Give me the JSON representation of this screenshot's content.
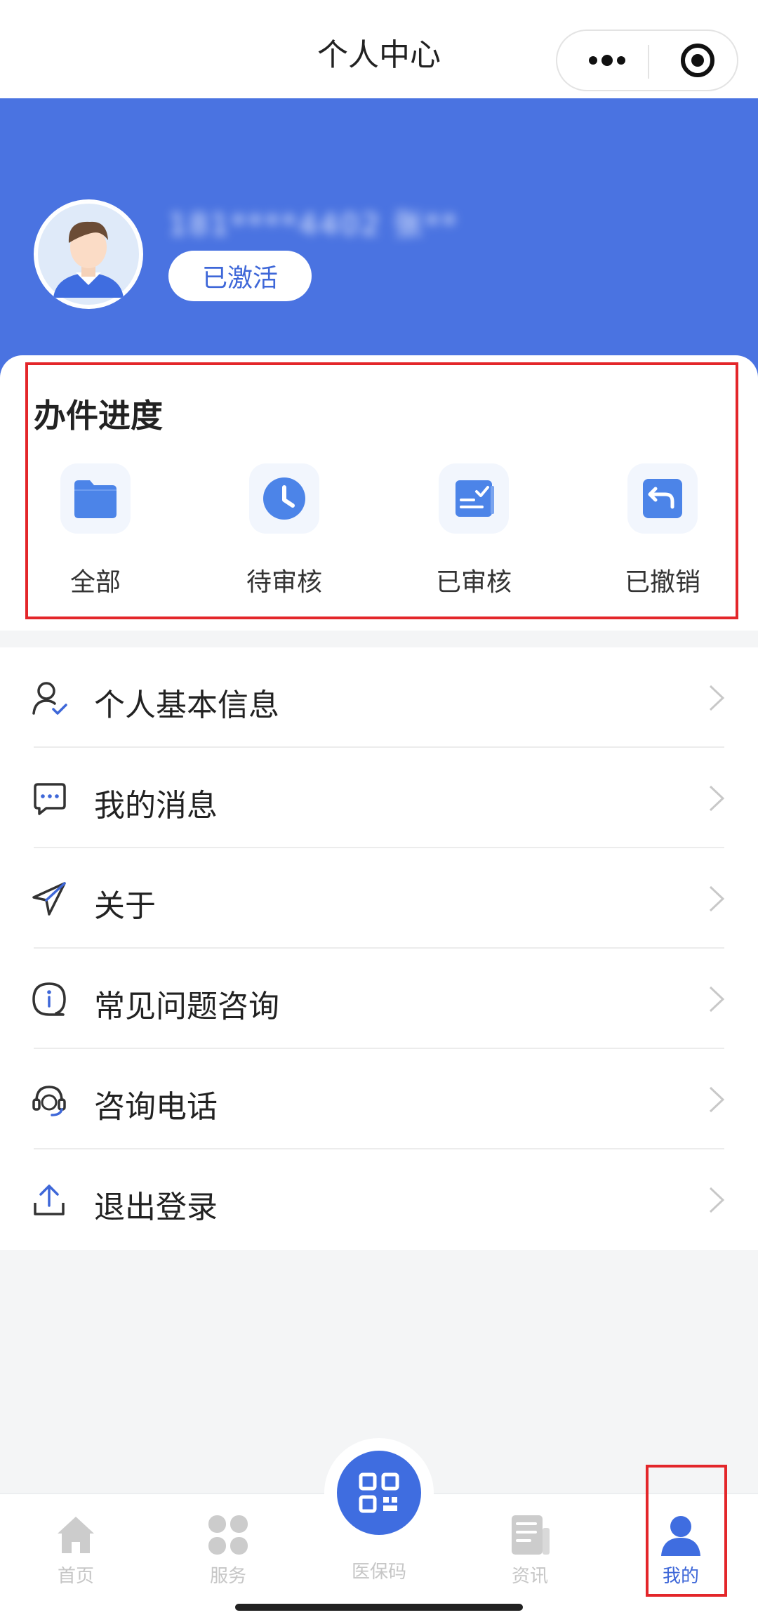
{
  "nav": {
    "title": "个人中心"
  },
  "user": {
    "name": "181****4402 张**",
    "status": "已激活"
  },
  "progress": {
    "title": "办件进度",
    "items": [
      {
        "label": "全部",
        "icon": "folder-icon"
      },
      {
        "label": "待审核",
        "icon": "clock-icon"
      },
      {
        "label": "已审核",
        "icon": "approved-doc-icon"
      },
      {
        "label": "已撤销",
        "icon": "undo-icon"
      }
    ]
  },
  "menu": [
    {
      "label": "个人基本信息",
      "icon": "user-check-icon"
    },
    {
      "label": "我的消息",
      "icon": "message-icon"
    },
    {
      "label": "关于",
      "icon": "send-icon"
    },
    {
      "label": "常见问题咨询",
      "icon": "info-chat-icon"
    },
    {
      "label": "咨询电话",
      "icon": "headset-icon"
    },
    {
      "label": "退出登录",
      "icon": "upload-icon"
    }
  ],
  "tabbar": {
    "items": [
      {
        "label": "首页",
        "icon": "home-icon",
        "active": false
      },
      {
        "label": "服务",
        "icon": "grid-icon",
        "active": false
      },
      {
        "label": "医保码",
        "icon": "qr-code-icon",
        "active": false
      },
      {
        "label": "资讯",
        "icon": "news-icon",
        "active": false
      },
      {
        "label": "我的",
        "icon": "profile-icon",
        "active": true
      }
    ]
  },
  "colors": {
    "primary": "#4a73e1",
    "accent": "#3e67d8",
    "highlight": "#e3262a",
    "inactive": "#c6c6c6"
  }
}
